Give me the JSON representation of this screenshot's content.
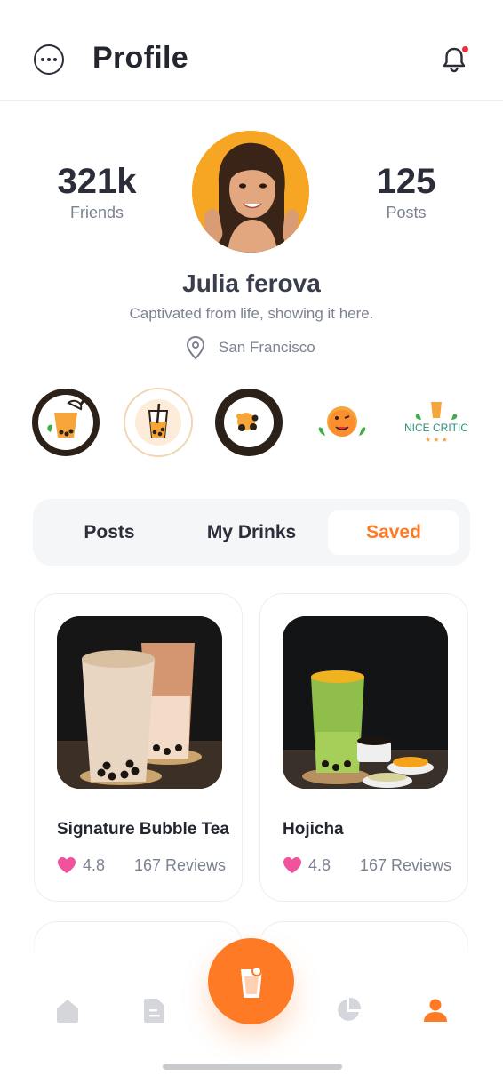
{
  "header": {
    "title": "Profile",
    "menu_icon": "more-circle-icon",
    "bell_icon": "bell-icon"
  },
  "profile": {
    "friends_count": "321k",
    "friends_label": "Friends",
    "posts_count": "125",
    "posts_label": "Posts",
    "name": "Julia ferova",
    "bio": "Captivated from life, showing it here.",
    "location": "San Francisco"
  },
  "badges": [
    {
      "name": "boba-drinker-badge"
    },
    {
      "name": "awesome-reviewer-badge"
    },
    {
      "name": "topping-lover-badge"
    },
    {
      "name": "pro-taste-tester-badge"
    },
    {
      "name": "nice-critic-badge"
    }
  ],
  "tabs": [
    {
      "label": "Posts",
      "active": false
    },
    {
      "label": "My Drinks",
      "active": false
    },
    {
      "label": "Saved",
      "active": true
    }
  ],
  "cards": [
    {
      "title": "Signature Bubble Tea",
      "rating": "4.8",
      "reviews": "167 Reviews"
    },
    {
      "title": "Hojicha",
      "rating": "4.8",
      "reviews": "167 Reviews"
    }
  ],
  "nav": {
    "items": [
      "home-icon",
      "document-icon",
      "drink-icon",
      "chart-icon",
      "profile-icon"
    ],
    "active": "profile-icon"
  },
  "colors": {
    "accent": "#ff7a24",
    "text_dark": "#2b2d3a",
    "text_muted": "#7c8291",
    "heart": "#f0529c"
  }
}
